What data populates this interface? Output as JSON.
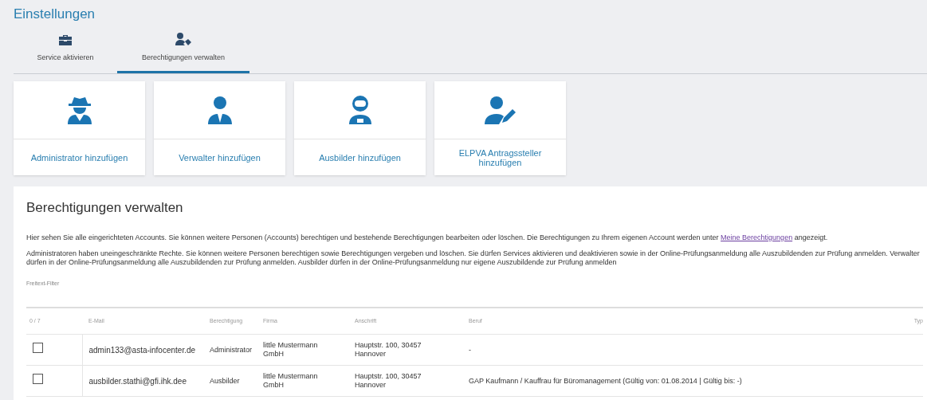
{
  "page_title": "Einstellungen",
  "tabs": [
    {
      "label": "Service aktivieren",
      "kind": "toolbox",
      "selected": false
    },
    {
      "label": "Berechtigungen verwalten",
      "kind": "usertag",
      "selected": true
    }
  ],
  "cards": [
    {
      "label": "Administrator hinzufügen",
      "kind": "spy"
    },
    {
      "label": "Verwalter hinzufügen",
      "kind": "suit"
    },
    {
      "label": "Ausbilder hinzufügen",
      "kind": "astronaut"
    },
    {
      "label": "ELPVA Antragssteller hinzufügen",
      "kind": "edit"
    }
  ],
  "section": {
    "title": "Berechtigungen verwalten",
    "intro": "Hier sehen Sie alle eingerichteten Accounts. Sie können weitere Personen (Accounts) berechtigen und bestehende Berechtigungen bearbeiten oder löschen. Die Berechtigungen zu Ihrem eigenen Account werden unter",
    "intro_link": "Meine Berechtigungen",
    "intro_end": "angezeigt.",
    "rights": "Administratoren haben uneingeschränkte Rechte. Sie können weitere Personen berechtigen sowie Berechtigungen vergeben und löschen. Sie dürfen Services aktivieren und deaktivieren sowie in der Online-Prüfungsanmeldung alle Auszubildenden zur Prüfung anmelden. Verwalter dürfen in der Online-Prüfungsanmeldung alle Auszubildenden zur Prüfung anmelden. Ausbilder dürfen in der Online-Prüfungsanmeldung nur eigene Auszubildende zur Prüfung anmelden",
    "filter_label": "Freitext-Filter"
  },
  "table": {
    "columns": [
      "0 / 7",
      "E-Mail",
      "Berechtigung",
      "Firma",
      "Anschrift",
      "Beruf",
      "Typ"
    ],
    "rows": [
      {
        "checked": false,
        "email": "admin133@asta-infocenter.de",
        "role": "Administrator",
        "company": "little Mustermann GmbH",
        "address": "Hauptstr. 100, 30457 Hannover",
        "profession": "-"
      },
      {
        "checked": false,
        "email": "ausbilder.stathi@gfi.ihk.dee",
        "role": "Ausbilder",
        "company": "little Mustermann GmbH",
        "address": "Hauptstr. 100, 30457 Hannover",
        "profession": "GAP Kaufmann / Kauffrau für Büromanagement (Gültig von: 01.08.2014 | Gültig bis: -)"
      }
    ]
  }
}
